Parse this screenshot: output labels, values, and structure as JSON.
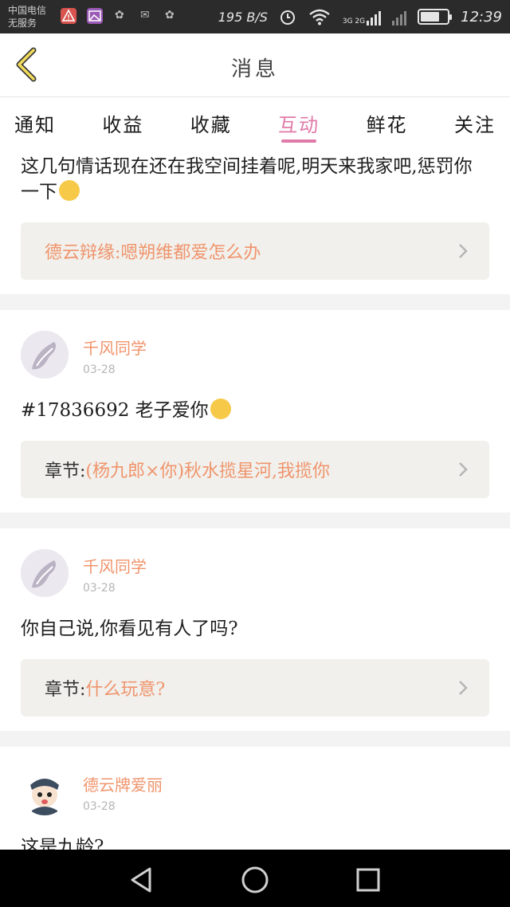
{
  "status_bar": {
    "carrier_line1": "中国电信",
    "carrier_line2": "无服务",
    "speed": "195 B/S",
    "network": "3G 2G",
    "time": "12:39",
    "battery_level": 0.72,
    "icons": [
      "warning-icon",
      "image-icon",
      "bird-icon",
      "mail-icon",
      "bird-icon",
      "alarm-icon",
      "wifi-icon",
      "signal-icon",
      "battery-icon"
    ]
  },
  "header": {
    "title": "消息",
    "back_icon": "chevron-left-icon"
  },
  "tabs": [
    {
      "label": "通知",
      "active": false
    },
    {
      "label": "收益",
      "active": false
    },
    {
      "label": "收藏",
      "active": false
    },
    {
      "label": "互动",
      "active": true
    },
    {
      "label": "鲜花",
      "active": false
    },
    {
      "label": "关注",
      "active": false
    }
  ],
  "items": [
    {
      "message": "这几句情话现在还在我空间挂着呢,明天来我家吧,惩罚你一下",
      "ref_key": "",
      "ref_value": "德云辩缘:嗯朔维都爱怎么办"
    },
    {
      "user": "千风同学",
      "date": "03-28",
      "message": "#17836692 老子爱你",
      "ref_key": "章节:",
      "ref_value": "(杨九郎×你)秋水揽星河,我揽你"
    },
    {
      "user": "千风同学",
      "date": "03-28",
      "message": "你自己说,你看见有人了吗?",
      "ref_key": "章节:",
      "ref_value": "什么玩意?"
    },
    {
      "user": "德云牌爱丽",
      "date": "03-28",
      "message": "这是九龄?"
    }
  ],
  "colors": {
    "accent": "#e07aa8",
    "orange": "#f0946c",
    "ref_bg": "#f1f0ec",
    "navbar": "#000000"
  },
  "navbar": {
    "icons": [
      "back-triangle-icon",
      "home-circle-icon",
      "recent-square-icon"
    ]
  }
}
